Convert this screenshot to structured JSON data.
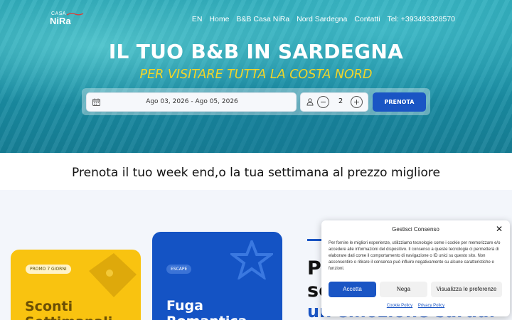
{
  "header": {
    "logo": {
      "small": "CASA",
      "big": "NiRa"
    },
    "nav": [
      "EN",
      "Home",
      "B&B Casa NiRa",
      "Nord Sardegna",
      "Contatti",
      "Tel: +393493328570"
    ]
  },
  "hero": {
    "title": "IL TUO B&B IN SARDEGNA",
    "subtitle": "PER VISITARE TUTTA LA COSTA NORD"
  },
  "booking": {
    "dates": "Ago 03, 2026 - Ago 05, 2026",
    "guests": "2",
    "minus": "−",
    "plus": "+",
    "button": "PRENOTA"
  },
  "band": {
    "text": "Prenota il tuo week end,o la tua settimana al prezzo migliore"
  },
  "cards": [
    {
      "tag": "PROMO 7 GIORNI",
      "title_line1": "Sconti",
      "title_line2": "Settimanali"
    },
    {
      "tag": "ESCAPE",
      "title_line1": "Fuga",
      "title_line2": "Romantica"
    }
  ],
  "right": {
    "heading_line1": "P",
    "heading_line2": "sc",
    "heading_blue": "un'emozione sarda."
  },
  "consent": {
    "title": "Gestisci Consenso",
    "close": "✕",
    "text": "Per fornire le migliori esperienze, utilizziamo tecnologie come i cookie per memorizzare e/o accedere alle informazioni del dispositivo. Il consenso a queste tecnologie ci permetterà di elaborare dati come il comportamento di navigazione o ID unici su questo sito. Non acconsentire o ritirare il consenso può influire negativamente su alcune caratteristiche e funzioni.",
    "accept": "Accetta",
    "deny": "Nega",
    "preferences": "Visualizza le preferenze",
    "cookie_policy": "Cookie Policy",
    "privacy_policy": "Privacy Policy"
  },
  "colors": {
    "primary": "#1a55c4",
    "accent": "#f2d629",
    "card_yellow": "#f9c310",
    "card_blue": "#1453c4"
  },
  "icons": {
    "calendar": "calendar-icon",
    "person": "person-icon"
  }
}
